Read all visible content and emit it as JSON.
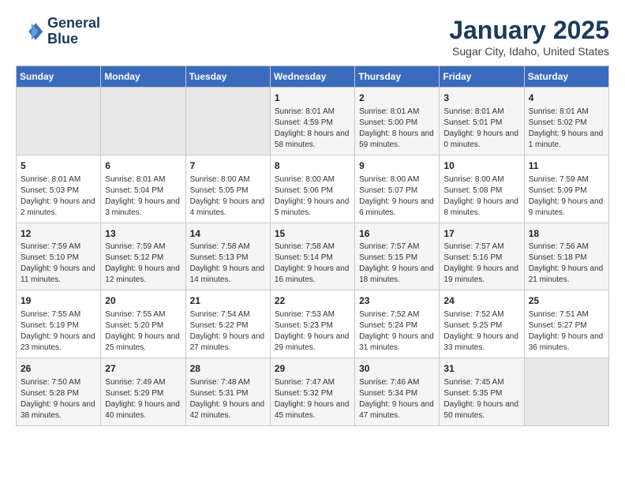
{
  "logo": {
    "line1": "General",
    "line2": "Blue"
  },
  "title": "January 2025",
  "subtitle": "Sugar City, Idaho, United States",
  "days_of_week": [
    "Sunday",
    "Monday",
    "Tuesday",
    "Wednesday",
    "Thursday",
    "Friday",
    "Saturday"
  ],
  "weeks": [
    [
      {
        "day": "",
        "info": ""
      },
      {
        "day": "",
        "info": ""
      },
      {
        "day": "",
        "info": ""
      },
      {
        "day": "1",
        "info": "Sunrise: 8:01 AM\nSunset: 4:59 PM\nDaylight: 8 hours and 58 minutes."
      },
      {
        "day": "2",
        "info": "Sunrise: 8:01 AM\nSunset: 5:00 PM\nDaylight: 8 hours and 59 minutes."
      },
      {
        "day": "3",
        "info": "Sunrise: 8:01 AM\nSunset: 5:01 PM\nDaylight: 9 hours and 0 minutes."
      },
      {
        "day": "4",
        "info": "Sunrise: 8:01 AM\nSunset: 5:02 PM\nDaylight: 9 hours and 1 minute."
      }
    ],
    [
      {
        "day": "5",
        "info": "Sunrise: 8:01 AM\nSunset: 5:03 PM\nDaylight: 9 hours and 2 minutes."
      },
      {
        "day": "6",
        "info": "Sunrise: 8:01 AM\nSunset: 5:04 PM\nDaylight: 9 hours and 3 minutes."
      },
      {
        "day": "7",
        "info": "Sunrise: 8:00 AM\nSunset: 5:05 PM\nDaylight: 9 hours and 4 minutes."
      },
      {
        "day": "8",
        "info": "Sunrise: 8:00 AM\nSunset: 5:06 PM\nDaylight: 9 hours and 5 minutes."
      },
      {
        "day": "9",
        "info": "Sunrise: 8:00 AM\nSunset: 5:07 PM\nDaylight: 9 hours and 6 minutes."
      },
      {
        "day": "10",
        "info": "Sunrise: 8:00 AM\nSunset: 5:08 PM\nDaylight: 9 hours and 8 minutes."
      },
      {
        "day": "11",
        "info": "Sunrise: 7:59 AM\nSunset: 5:09 PM\nDaylight: 9 hours and 9 minutes."
      }
    ],
    [
      {
        "day": "12",
        "info": "Sunrise: 7:59 AM\nSunset: 5:10 PM\nDaylight: 9 hours and 11 minutes."
      },
      {
        "day": "13",
        "info": "Sunrise: 7:59 AM\nSunset: 5:12 PM\nDaylight: 9 hours and 12 minutes."
      },
      {
        "day": "14",
        "info": "Sunrise: 7:58 AM\nSunset: 5:13 PM\nDaylight: 9 hours and 14 minutes."
      },
      {
        "day": "15",
        "info": "Sunrise: 7:58 AM\nSunset: 5:14 PM\nDaylight: 9 hours and 16 minutes."
      },
      {
        "day": "16",
        "info": "Sunrise: 7:57 AM\nSunset: 5:15 PM\nDaylight: 9 hours and 18 minutes."
      },
      {
        "day": "17",
        "info": "Sunrise: 7:57 AM\nSunset: 5:16 PM\nDaylight: 9 hours and 19 minutes."
      },
      {
        "day": "18",
        "info": "Sunrise: 7:56 AM\nSunset: 5:18 PM\nDaylight: 9 hours and 21 minutes."
      }
    ],
    [
      {
        "day": "19",
        "info": "Sunrise: 7:55 AM\nSunset: 5:19 PM\nDaylight: 9 hours and 23 minutes."
      },
      {
        "day": "20",
        "info": "Sunrise: 7:55 AM\nSunset: 5:20 PM\nDaylight: 9 hours and 25 minutes."
      },
      {
        "day": "21",
        "info": "Sunrise: 7:54 AM\nSunset: 5:22 PM\nDaylight: 9 hours and 27 minutes."
      },
      {
        "day": "22",
        "info": "Sunrise: 7:53 AM\nSunset: 5:23 PM\nDaylight: 9 hours and 29 minutes."
      },
      {
        "day": "23",
        "info": "Sunrise: 7:52 AM\nSunset: 5:24 PM\nDaylight: 9 hours and 31 minutes."
      },
      {
        "day": "24",
        "info": "Sunrise: 7:52 AM\nSunset: 5:25 PM\nDaylight: 9 hours and 33 minutes."
      },
      {
        "day": "25",
        "info": "Sunrise: 7:51 AM\nSunset: 5:27 PM\nDaylight: 9 hours and 36 minutes."
      }
    ],
    [
      {
        "day": "26",
        "info": "Sunrise: 7:50 AM\nSunset: 5:28 PM\nDaylight: 9 hours and 38 minutes."
      },
      {
        "day": "27",
        "info": "Sunrise: 7:49 AM\nSunset: 5:29 PM\nDaylight: 9 hours and 40 minutes."
      },
      {
        "day": "28",
        "info": "Sunrise: 7:48 AM\nSunset: 5:31 PM\nDaylight: 9 hours and 42 minutes."
      },
      {
        "day": "29",
        "info": "Sunrise: 7:47 AM\nSunset: 5:32 PM\nDaylight: 9 hours and 45 minutes."
      },
      {
        "day": "30",
        "info": "Sunrise: 7:46 AM\nSunset: 5:34 PM\nDaylight: 9 hours and 47 minutes."
      },
      {
        "day": "31",
        "info": "Sunrise: 7:45 AM\nSunset: 5:35 PM\nDaylight: 9 hours and 50 minutes."
      },
      {
        "day": "",
        "info": ""
      }
    ]
  ]
}
